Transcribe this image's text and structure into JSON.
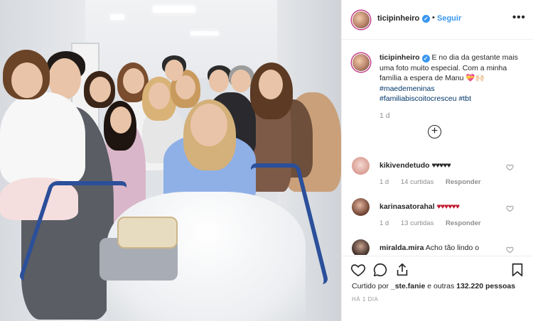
{
  "post": {
    "username": "ticipinheiro",
    "verified_icon": "verified-badge-icon",
    "separator": "•",
    "follow_label": "Seguir",
    "more_label": "•••"
  },
  "caption": {
    "username": "ticipinheiro",
    "text": "E no dia da gestante mais uma foto muito especial. Com a minha família a espera de Manu 💝🙌🏻",
    "hashtags": [
      "#maedemeninas",
      "#familiabiscoitocresceu",
      "#tbt"
    ],
    "time": "1 d",
    "load_more_icon": "plus-circle-icon"
  },
  "comments": [
    {
      "username": "kikivendetudo",
      "text": "♥♥♥♥♥",
      "time": "1 d",
      "likes": "14 curtidas",
      "reply": "Responder",
      "heart_color": "#262626"
    },
    {
      "username": "karinasatorahal",
      "text": "♥♥♥♥♥♥",
      "time": "1 d",
      "likes": "13 curtidas",
      "reply": "Responder",
      "heart_color": "#c0182d"
    },
    {
      "username": "miralda.mira",
      "text": "Acho tão lindo o",
      "time": "",
      "likes": "",
      "reply": ""
    }
  ],
  "actions": {
    "icons": [
      "heart-icon",
      "comment-icon",
      "share-icon",
      "bookmark-icon"
    ],
    "liked_by_prefix": "Curtido por",
    "liked_by_user": "_ste.fanie",
    "liked_by_suffix": "e outras",
    "liked_by_count": "132.220",
    "liked_by_unit": "pessoas",
    "time_ago": "HÁ 1 DIA"
  },
  "colors": {
    "accent": "#3897f0",
    "hashtag": "#003569",
    "muted": "#8e8e8e",
    "rail": "#2b4f9a",
    "gown": "#8fb0e6"
  }
}
